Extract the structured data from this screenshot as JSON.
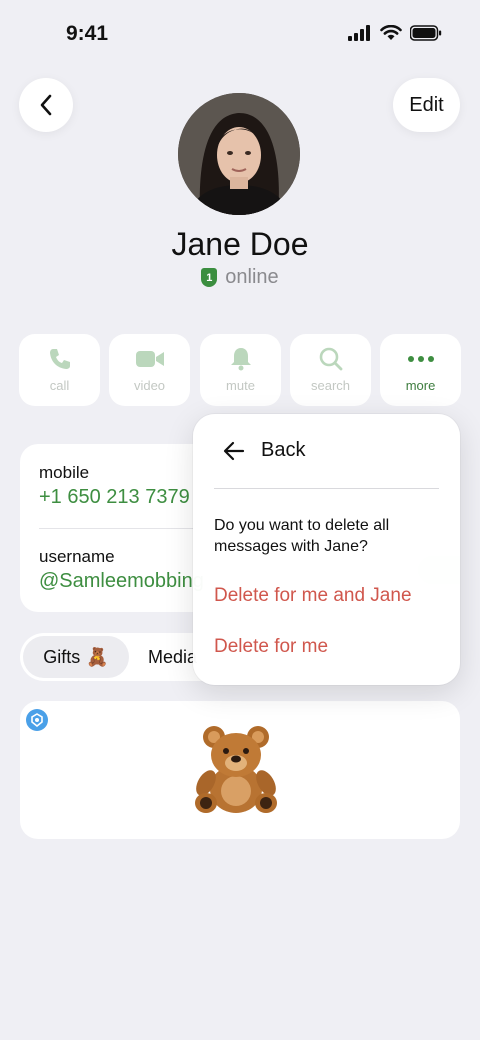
{
  "status_bar": {
    "time": "9:41"
  },
  "header": {
    "edit_label": "Edit"
  },
  "profile": {
    "name": "Jane Doe",
    "badge_number": "1",
    "status": "online"
  },
  "actions": [
    {
      "label": "call",
      "icon": "phone-icon"
    },
    {
      "label": "video",
      "icon": "video-icon"
    },
    {
      "label": "mute",
      "icon": "bell-icon"
    },
    {
      "label": "search",
      "icon": "search-icon"
    },
    {
      "label": "more",
      "icon": "more-icon"
    }
  ],
  "info": {
    "mobile_label": "mobile",
    "mobile_value": "+1 650 213 7379",
    "username_label": "username",
    "username_value": "@Samleemobbing"
  },
  "tabs": {
    "gifts_label": "Gifts",
    "gifts_emoji": "🧸",
    "media_label": "Media"
  },
  "gift": {
    "emoji": "🧸"
  },
  "context_menu": {
    "back_label": "Back",
    "question": "Do you want to delete all messages with Jane?",
    "delete_both": "Delete for me and Jane",
    "delete_me": "Delete for me"
  },
  "colors": {
    "accent_green": "#3e8e41",
    "destructive_red": "#d0574d",
    "background": "#efeff4"
  }
}
